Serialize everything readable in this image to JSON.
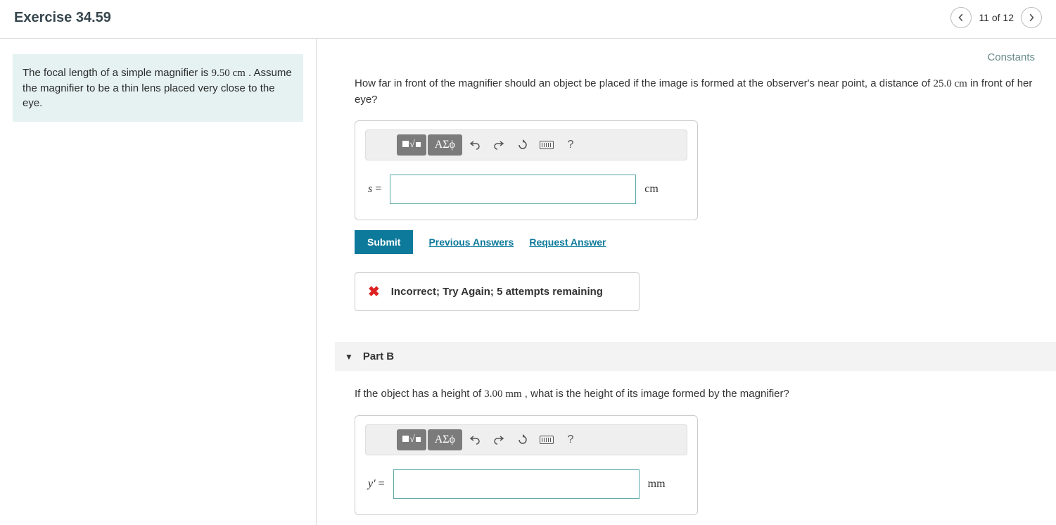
{
  "header": {
    "title": "Exercise 34.59",
    "page_label": "11 of 12"
  },
  "constants_label": "Constants",
  "problem": {
    "text_before": "The focal length of a simple magnifier is ",
    "val1": "9.50 cm",
    "text_after": " . Assume the magnifier to be a thin lens placed very close to the eye."
  },
  "partA": {
    "q_before": "How far in front of the magnifier should an object be placed if the image is formed at the observer's near point, a distance of ",
    "q_val": "25.0 cm",
    "q_after": " in front of her eye?",
    "var": "s",
    "eq": "=",
    "unit": "cm",
    "input_value": "",
    "submit": "Submit",
    "prev": "Previous Answers",
    "req": "Request Answer",
    "feedback": "Incorrect; Try Again; 5 attempts remaining"
  },
  "partB": {
    "title": "Part B",
    "q_before": "If the object has a height of ",
    "q_val": "3.00 mm",
    "q_after": " , what is the height of its image formed by the magnifier?",
    "var": "y′",
    "eq": "=",
    "unit": "mm",
    "input_value": ""
  },
  "toolbar": {
    "greek": "ΑΣϕ",
    "help": "?"
  }
}
